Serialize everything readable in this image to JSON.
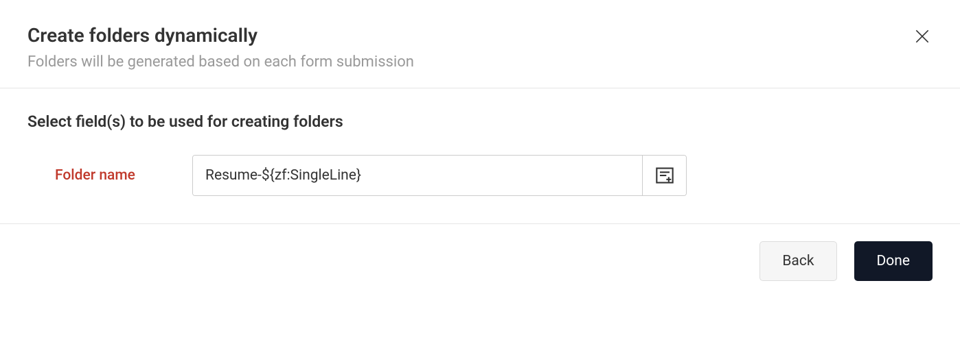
{
  "header": {
    "title": "Create folders dynamically",
    "subtitle": "Folders will be generated based on each form submission"
  },
  "content": {
    "section_title": "Select field(s) to be used for creating folders",
    "folder_name_label": "Folder name",
    "folder_name_value": "Resume-${zf:SingleLine}"
  },
  "footer": {
    "back_label": "Back",
    "done_label": "Done"
  }
}
